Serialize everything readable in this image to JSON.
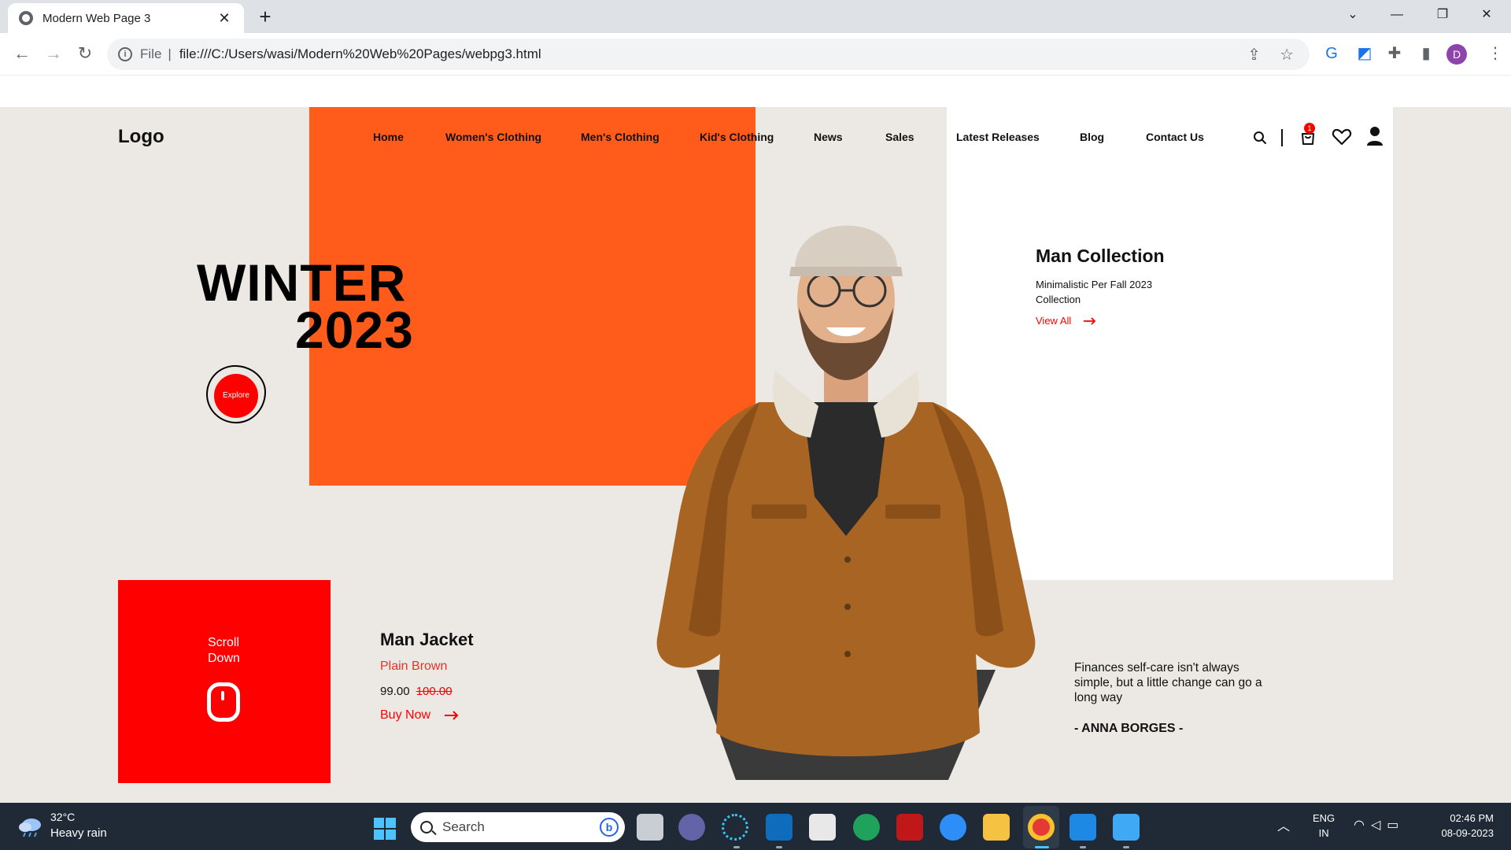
{
  "browser": {
    "tab_title": "Modern Web Page 3",
    "tab_close": "✕",
    "new_tab": "+",
    "minimize": "—",
    "restore": "❐",
    "close": "✕",
    "back": "←",
    "forward": "→",
    "reload": "↻",
    "file_label": "File",
    "separator": "|",
    "url": "file:///C:/Users/wasi/Modern%20Web%20Pages/webpg3.html",
    "profile_initial": "D"
  },
  "site": {
    "logo": "Logo",
    "nav": [
      {
        "label": "Home"
      },
      {
        "label": "Women's Clothing"
      },
      {
        "label": "Men's Clothing"
      },
      {
        "label": "Kid's Clothing"
      },
      {
        "label": "News"
      },
      {
        "label": "Sales"
      },
      {
        "label": "Latest Releases"
      },
      {
        "label": "Blog"
      },
      {
        "label": "Contact Us"
      }
    ],
    "cart_count": "1",
    "hero": {
      "line1": "WINTER",
      "line2": "2023",
      "explore": "Explore"
    },
    "collection": {
      "title": "Man Collection",
      "description": "Minimalistic Per Fall 2023 Collection",
      "link": "View All"
    },
    "scroll": {
      "label": "Scroll Down"
    },
    "product": {
      "title": "Man Jacket",
      "variant": "Plain Brown",
      "price": "99.00",
      "old_price": "100.00",
      "cta": "Buy Now"
    },
    "quote": {
      "text": "Finances self-care isn't always simple, but a little change can go a long way",
      "author": "- ANNA BORGES -"
    },
    "colors": {
      "background": "#ece8e3",
      "orange": "#ff5c1c",
      "red": "#ff0000"
    }
  },
  "taskbar": {
    "weather_temp": "32°C",
    "weather_desc": "Heavy rain",
    "search_placeholder": "Search",
    "lang_line1": "ENG",
    "lang_line2": "IN",
    "time": "02:46 PM",
    "date": "08-09-2023",
    "apps": [
      "file-explorer-task-view",
      "teams",
      "slack",
      "outlook",
      "store",
      "edge",
      "mcafee",
      "tips",
      "file-explorer",
      "chrome",
      "vscode",
      "photos"
    ]
  }
}
